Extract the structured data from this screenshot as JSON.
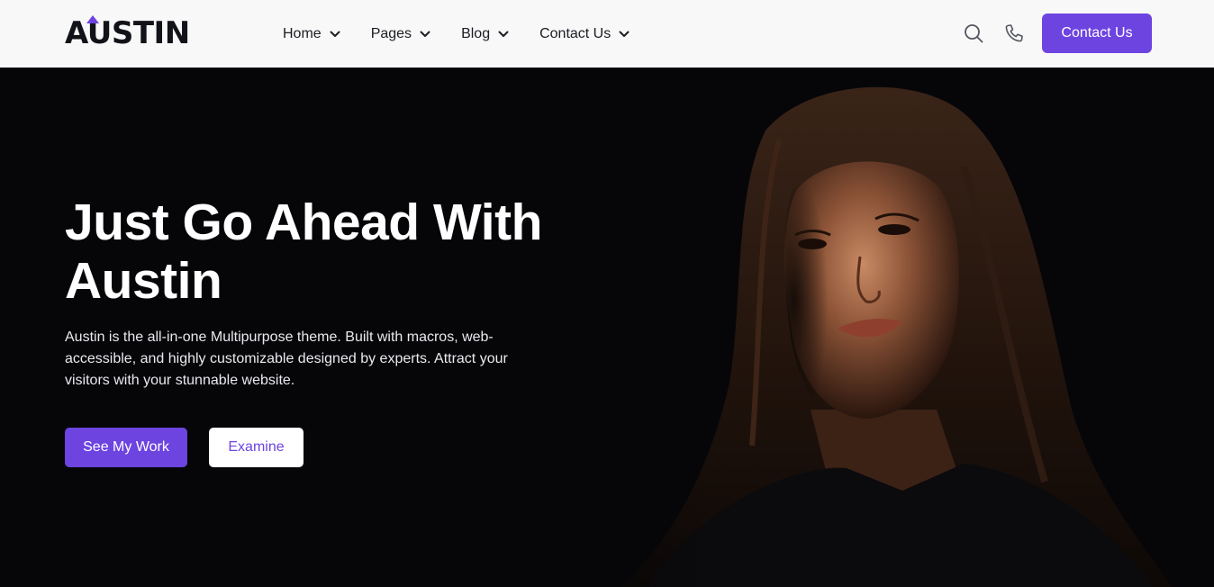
{
  "brand": {
    "logo_text": "AUSTIN",
    "accent_color": "#6d44e0"
  },
  "nav": {
    "items": [
      {
        "label": "Home",
        "icon": "chevron-down-icon"
      },
      {
        "label": "Pages",
        "icon": "chevron-down-icon"
      },
      {
        "label": "Blog",
        "icon": "chevron-down-icon"
      },
      {
        "label": "Contact Us",
        "icon": "chevron-down-icon"
      }
    ]
  },
  "header_actions": {
    "search_icon": "search-icon",
    "phone_icon": "phone-icon",
    "cta_label": "Contact Us"
  },
  "hero": {
    "title_line1": "Just Go Ahead With",
    "title_line2": "Austin",
    "description": "Austin is the all-in-one Multipurpose theme. Built with macros, web-accessible, and highly customizable designed by experts. Attract your visitors with your stunnable website.",
    "primary_button": "See My Work",
    "secondary_button": "Examine",
    "background_color": "#060609",
    "image": "woman-portrait"
  }
}
